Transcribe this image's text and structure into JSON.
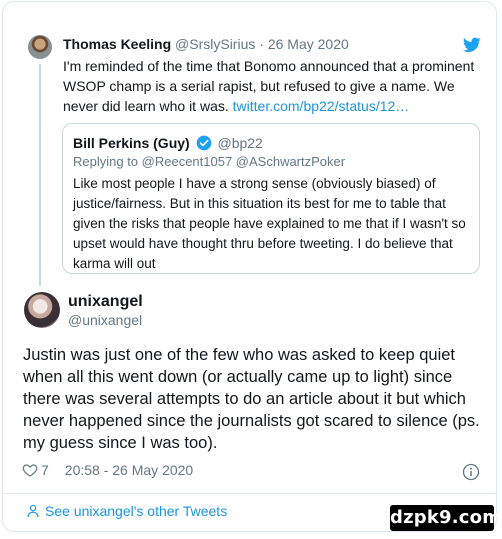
{
  "parent_tweet": {
    "name": "Thomas Keeling",
    "handle": "@SrslySirius",
    "separator": "·",
    "date": "26 May 2020",
    "text": "I'm reminded of the time that Bonomo announced that a prominent WSOP champ is a serial rapist, but refused to give a name. We never did learn who it was.",
    "link": "twitter.com/bp22/status/12…"
  },
  "quoted_tweet": {
    "name": "Bill Perkins (Guy)",
    "handle": "@bp22",
    "reply_to": "Replying to @Reecent1057 @ASchwartzPoker",
    "text": "Like most people I have a strong sense  (obviously biased) of justice/fairness. But in this situation its best for me to table that given the risks that people have explained to me that if I wasn't so upset would have thought thru before tweeting. I do believe that karma will out"
  },
  "main_tweet": {
    "name": "unixangel",
    "handle": "@unixangel",
    "text": "Justin was just one of the few who was asked to keep quiet when all this went down (or actually came up to light) since there was several attempts to do an article about it but which never happened since the journalists got scared to silence (ps. my guess since I was too).",
    "likes": "7",
    "timestamp": "20:58 - 26 May 2020"
  },
  "footer": {
    "other_tweets_label": "See unixangel's other Tweets"
  },
  "watermark": "dzpk9.com",
  "colors": {
    "link": "#1b95e0",
    "muted": "#657786",
    "border": "#e1e8ed"
  },
  "icons": [
    "twitter-bird-icon",
    "verified-badge-icon",
    "heart-icon",
    "info-icon",
    "person-icon"
  ]
}
